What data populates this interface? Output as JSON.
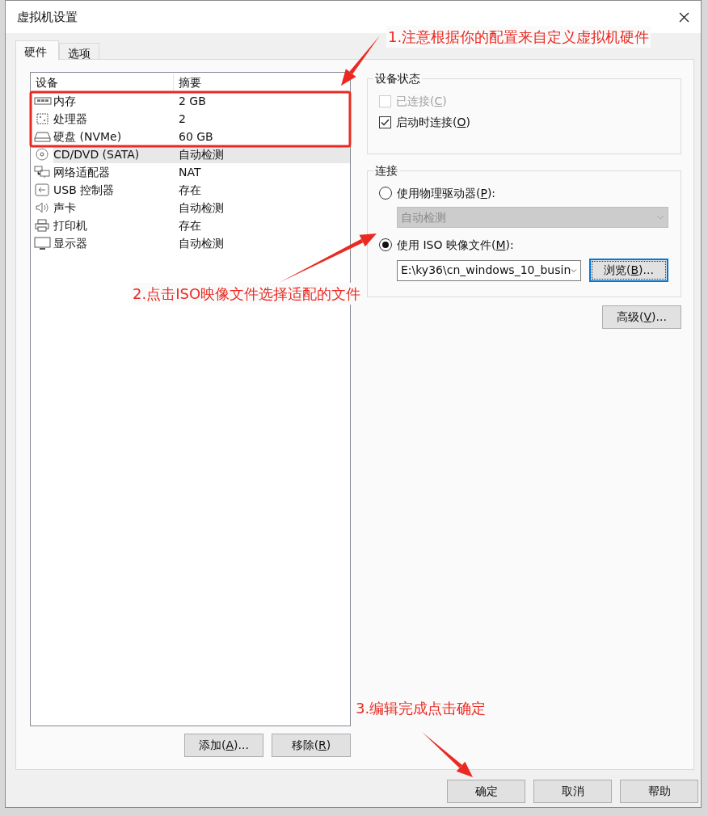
{
  "window": {
    "title": "虚拟机设置"
  },
  "tabs": [
    {
      "label": "硬件",
      "selected": true
    },
    {
      "label": "选项",
      "selected": false
    }
  ],
  "device_table": {
    "columns": [
      "设备",
      "摘要"
    ],
    "rows": [
      {
        "kind": "memory",
        "device": "内存",
        "summary": "2 GB",
        "selected": false
      },
      {
        "kind": "cpu",
        "device": "处理器",
        "summary": "2",
        "selected": false
      },
      {
        "kind": "disk",
        "device": "硬盘 (NVMe)",
        "summary": "60 GB",
        "selected": false
      },
      {
        "kind": "cdrom",
        "device": "CD/DVD (SATA)",
        "summary": "自动检测",
        "selected": true
      },
      {
        "kind": "network",
        "device": "网络适配器",
        "summary": "NAT",
        "selected": false
      },
      {
        "kind": "usb",
        "device": "USB 控制器",
        "summary": "存在",
        "selected": false
      },
      {
        "kind": "sound",
        "device": "声卡",
        "summary": "自动检测",
        "selected": false
      },
      {
        "kind": "printer",
        "device": "打印机",
        "summary": "存在",
        "selected": false
      },
      {
        "kind": "display",
        "device": "显示器",
        "summary": "自动检测",
        "selected": false
      }
    ]
  },
  "device_status": {
    "title": "设备状态",
    "options": [
      {
        "label": "已连接(C)",
        "checked": false,
        "disabled": true
      },
      {
        "label": "启动时连接(O)",
        "checked": true,
        "disabled": false
      }
    ]
  },
  "connection": {
    "title": "连接",
    "options": [
      {
        "label": "使用物理驱动器(P):",
        "selected": false,
        "dropdown": {
          "value": "自动检测",
          "disabled": true
        }
      },
      {
        "label": "使用 ISO 映像文件(M):",
        "selected": true,
        "dropdown": {
          "value": "E:\\ky36\\cn_windows_10_busin",
          "disabled": false
        },
        "browse_button": {
          "label": "浏览(B)...",
          "focused": true
        }
      }
    ]
  },
  "advanced_button": {
    "label": "高级(V)..."
  },
  "list_buttons": [
    {
      "label": "添加(A)..."
    },
    {
      "label": "移除(R)"
    }
  ],
  "dialog_buttons": [
    {
      "label": "确定"
    },
    {
      "label": "取消"
    },
    {
      "label": "帮助"
    }
  ],
  "annotations": [
    {
      "text": "1.注意根据你的配置来自定义虚拟机硬件"
    },
    {
      "text": "2.点击ISO映像文件选择适配的文件"
    },
    {
      "text": "3.编辑完成点击确定"
    }
  ]
}
